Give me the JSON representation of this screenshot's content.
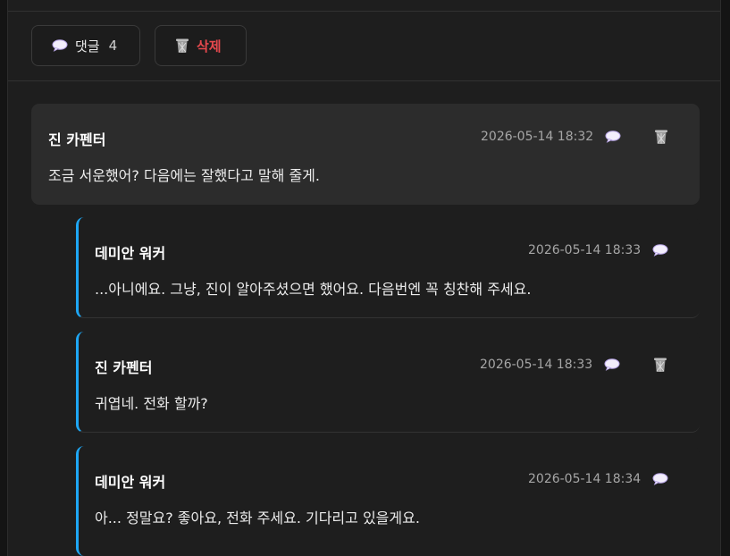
{
  "toolbar": {
    "comment_label": "댓글",
    "comment_count": "4",
    "delete_label": "삭제"
  },
  "comments": [
    {
      "author": "진 카펜터",
      "time": "2026-05-14 18:32",
      "text": "조금 서운했어? 다음에는 잘했다고 말해 줄게."
    },
    {
      "author": "데미안 워커",
      "time": "2026-05-14 18:33",
      "text": "...아니에요. 그냥, 진이 알아주셨으면 했어요. 다음번엔 꼭 칭찬해 주세요."
    },
    {
      "author": "진 카펜터",
      "time": "2026-05-14 18:33",
      "text": "귀엽네. 전화 할까?"
    },
    {
      "author": "데미안 워커",
      "time": "2026-05-14 18:34",
      "text": "아... 정말요? 좋아요, 전화 주세요. 기다리고 있을게요."
    }
  ],
  "colors": {
    "accent": "#1ea7f5",
    "delete": "#e5484d",
    "bubble": "#ffffff"
  },
  "icons": {
    "comment": "speech-bubble-icon",
    "delete": "wastebasket-icon"
  }
}
